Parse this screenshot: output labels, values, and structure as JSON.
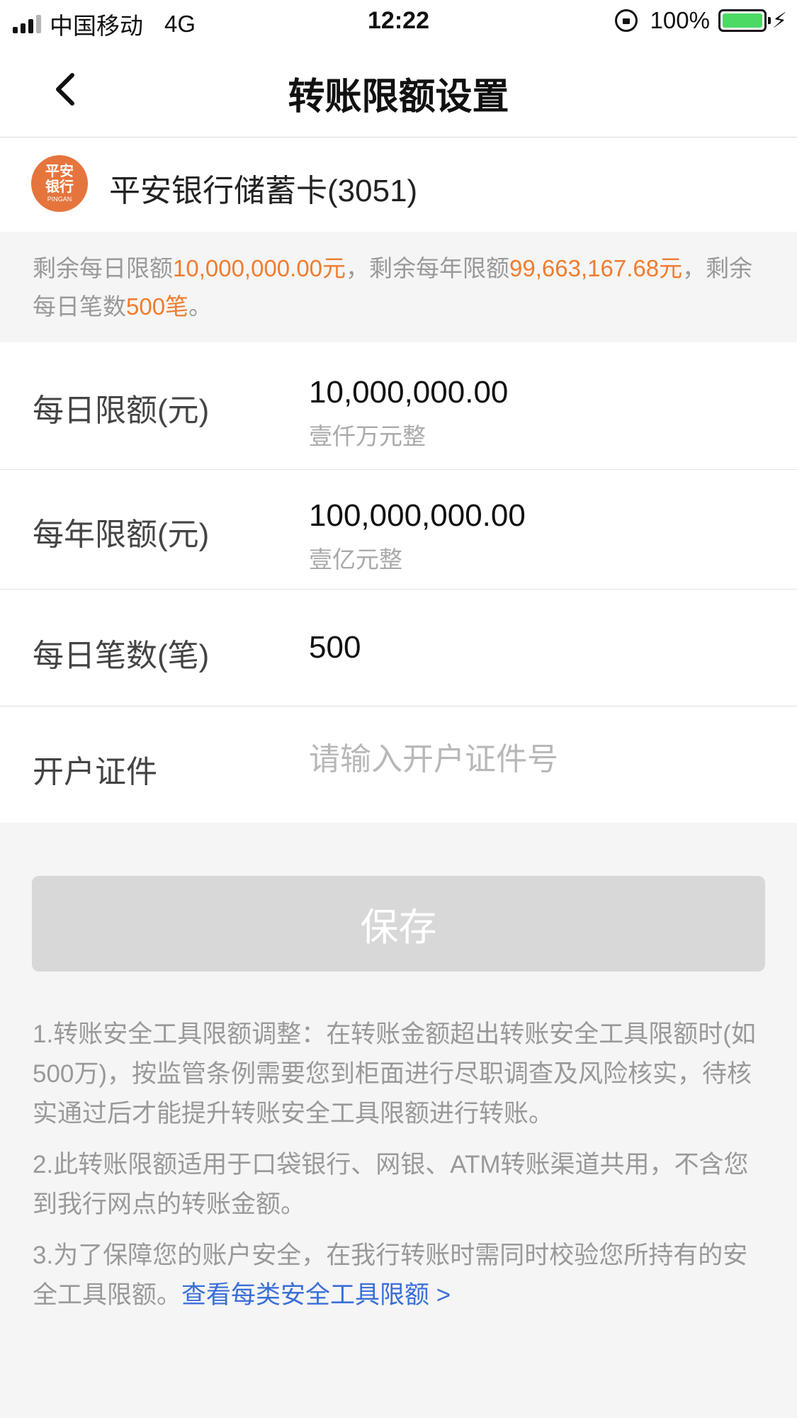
{
  "status_bar": {
    "carrier": "中国移动",
    "network": "4G",
    "time": "12:22",
    "battery": "100%",
    "icons": [
      "signal-icon",
      "orientation-lock-icon",
      "battery-icon",
      "charging-bolt-icon"
    ]
  },
  "nav": {
    "title": "转账限额设置",
    "back_icon": "chevron-left-icon"
  },
  "card": {
    "logo_line1": "平安",
    "logo_line2": "银行",
    "logo_line3": "PINGAN",
    "name": "平安银行储蓄卡(3051)"
  },
  "remaining": {
    "p1": "剩余每日限额",
    "daily_amount": "10,000,000.00元",
    "p2": "，剩余每年限额",
    "yearly_amount": "99,663,167.68元",
    "p3": "，剩余每日笔数",
    "daily_count": "500笔",
    "p4": "。"
  },
  "form": {
    "daily_limit": {
      "label": "每日限额(元)",
      "value": "10,000,000.00",
      "chinese": "壹仟万元整"
    },
    "yearly_limit": {
      "label": "每年限额(元)",
      "value": "100,000,000.00",
      "chinese": "壹亿元整"
    },
    "daily_count": {
      "label": "每日笔数(笔)",
      "value": "500"
    },
    "id_document": {
      "label": "开户证件",
      "value": "",
      "placeholder": "请输入开户证件号"
    }
  },
  "save_label": "保存",
  "notes": {
    "n1": "1.转账安全工具限额调整：在转账金额超出转账安全工具限额时(如500万)，按监管条例需要您到柜面进行尽职调查及风险核实，待核实通过后才能提升转账安全工具限额进行转账。",
    "n2": "2.此转账限额适用于口袋银行、网银、ATM转账渠道共用，不含您到我行网点的转账金额。",
    "n3": "3.为了保障您的账户安全，在我行转账时需同时校验您所持有的安全工具限额。",
    "n3_link": "查看每类安全工具限额 >"
  },
  "colors": {
    "accent_orange": "#f07c2e",
    "link_blue": "#3a6fd8",
    "bank_logo": "#e5753d",
    "button_disabled": "#d8d8d8"
  }
}
